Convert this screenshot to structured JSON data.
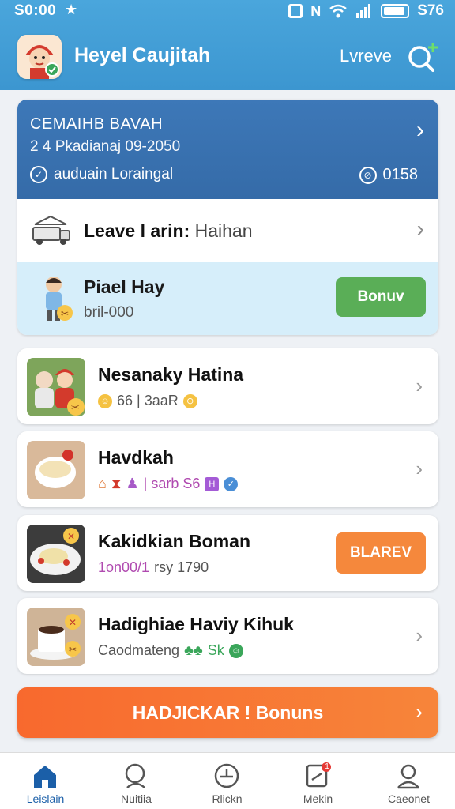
{
  "status": {
    "time": "S0:00",
    "battery_text": "S76"
  },
  "header": {
    "title": "Heyel Caujitah",
    "link": "Lvreve"
  },
  "banner": {
    "title": "CEMAIHB BAVAH",
    "subtitle": "2 4 Pkadianaj 09-2050",
    "footer": "auduain Loraingal",
    "count": "0158"
  },
  "leave_row": {
    "label": "Leave l arin:",
    "value": "Haihan"
  },
  "promo": {
    "title": "Piael Hay",
    "subtitle": "bril-000",
    "button": "Bonuv"
  },
  "cards": [
    {
      "title": "Nesanaky Hatina",
      "meta": "66 | 3aaR",
      "action": "chevron"
    },
    {
      "title": "Havdkah",
      "meta": "| sarb S6",
      "action": "chevron"
    },
    {
      "title": "Kakidkian Boman",
      "meta_a": "1on00/1",
      "meta_b": "rsy 1790",
      "action": "button",
      "button": "BLAREV"
    },
    {
      "title": "Hadighiae Haviy Kihuk",
      "meta_a": "Caodmateng",
      "meta_b": "Sk",
      "action": "chevron"
    }
  ],
  "cta": {
    "label": "HADJICKAR ! Bonuns"
  },
  "nav": [
    {
      "label": "Leislain",
      "active": true
    },
    {
      "label": "Nuitiia",
      "active": false
    },
    {
      "label": "Rlickn",
      "active": false
    },
    {
      "label": "Mekin",
      "active": false,
      "badge": "1"
    },
    {
      "label": "Caeonet",
      "active": false
    }
  ],
  "colors": {
    "header": "#4aa6dc",
    "banner": "#3d78b8",
    "promo_bg": "#d6eefa",
    "green_button": "#5aae57",
    "orange": "#f5883c",
    "active_nav": "#1b5fa8"
  }
}
